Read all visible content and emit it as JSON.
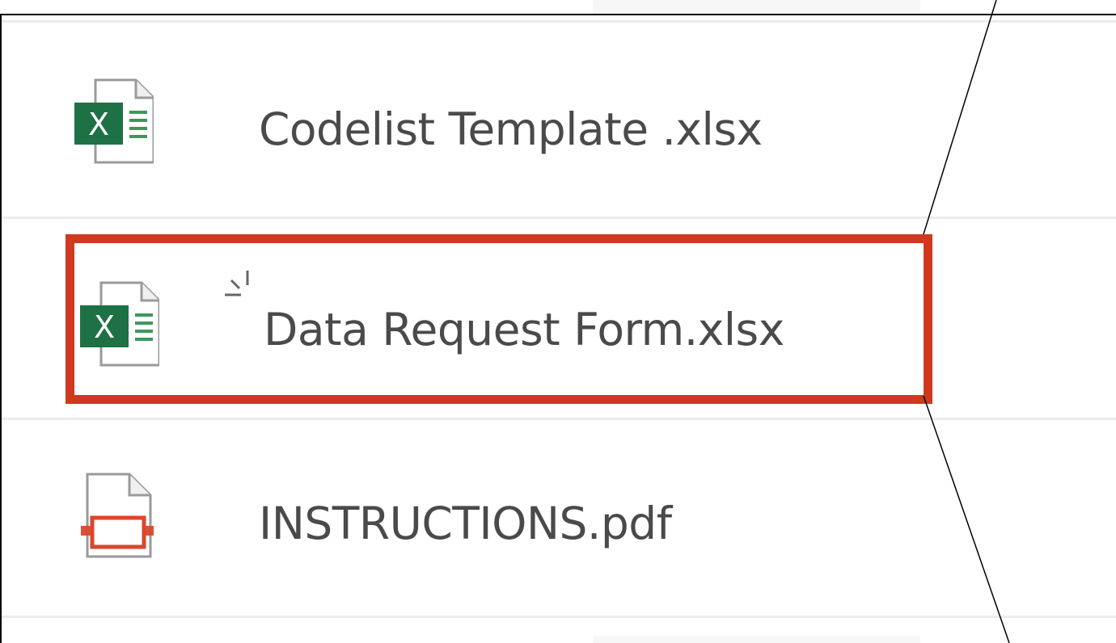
{
  "files": [
    {
      "name": "Codelist Template .xlsx",
      "icon": "excel-file-icon",
      "type": "xlsx"
    },
    {
      "name": "Data Request Form.xlsx",
      "icon": "excel-file-icon",
      "type": "xlsx",
      "highlighted": true
    },
    {
      "name": "INSTRUCTIONS.pdf",
      "icon": "pdf-file-icon",
      "type": "pdf"
    }
  ],
  "colors": {
    "excel_green": "#1e7145",
    "pdf_red": "#d9472b",
    "highlight_red": "#d0391f",
    "text": "#4a4a4a",
    "separator": "#ececec"
  }
}
